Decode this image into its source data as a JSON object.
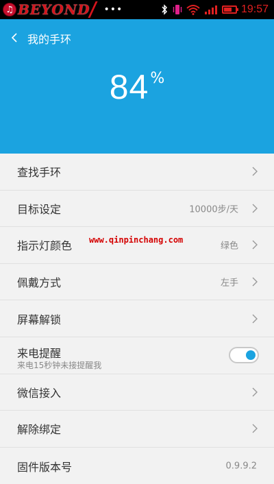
{
  "status_bar": {
    "brand_text": "BEYOND",
    "more": "•••",
    "time": "19:57"
  },
  "header": {
    "title": "我的手环",
    "battery_value": "84",
    "battery_unit": "%",
    "background_color": "#1ba3e0"
  },
  "watermark": "www.qinpinchang.com",
  "settings": [
    {
      "label": "查找手环",
      "value": "",
      "control": "chevron"
    },
    {
      "label": "目标设定",
      "value": "10000步/天",
      "control": "chevron"
    },
    {
      "label": "指示灯颜色",
      "value": "绿色",
      "control": "chevron"
    },
    {
      "label": "佩戴方式",
      "value": "左手",
      "control": "chevron"
    },
    {
      "label": "屏幕解锁",
      "value": "",
      "control": "chevron"
    },
    {
      "label": "来电提醒",
      "sublabel": "来电15秒钟未接提醒我",
      "control": "toggle",
      "toggle_on": true
    },
    {
      "label": "微信接入",
      "value": "",
      "control": "chevron"
    },
    {
      "label": "解除绑定",
      "value": "",
      "control": "chevron"
    },
    {
      "label": "固件版本号",
      "value": "0.9.9.2",
      "control": "none"
    }
  ]
}
